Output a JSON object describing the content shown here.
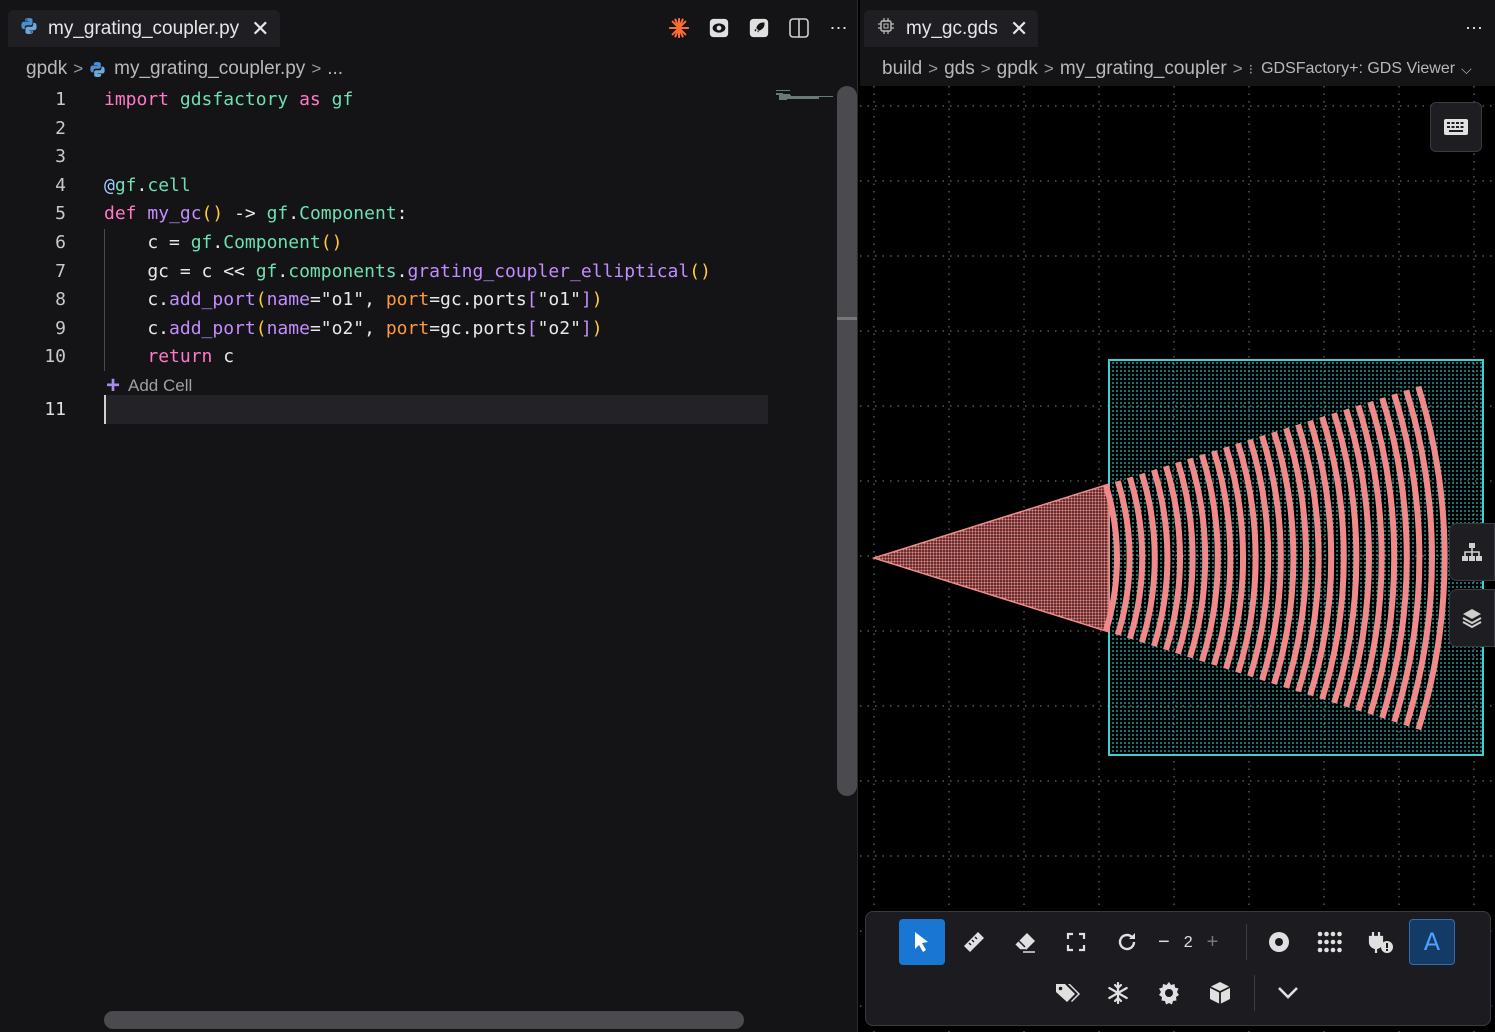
{
  "editor": {
    "tab": {
      "label": "my_grating_coupler.py",
      "close": "✕"
    },
    "breadcrumb": [
      "gpdk",
      "my_grating_coupler.py",
      "..."
    ],
    "lines": [
      {
        "n": "1",
        "tokens": [
          [
            "k",
            "import"
          ],
          [
            "w",
            " "
          ],
          [
            "m",
            "gdsfactory"
          ],
          [
            "w",
            " "
          ],
          [
            "k",
            "as"
          ],
          [
            "w",
            " "
          ],
          [
            "m",
            "gf"
          ]
        ]
      },
      {
        "n": "2",
        "tokens": []
      },
      {
        "n": "3",
        "tokens": []
      },
      {
        "n": "4",
        "tokens": [
          [
            "d",
            "@"
          ],
          [
            "m",
            "gf"
          ],
          [
            "w",
            "."
          ],
          [
            "m",
            "cell"
          ]
        ]
      },
      {
        "n": "5",
        "tokens": [
          [
            "k",
            "def"
          ],
          [
            "w",
            " "
          ],
          [
            "f",
            "my_gc"
          ],
          [
            "p",
            "()"
          ],
          [
            "w",
            " -> "
          ],
          [
            "m",
            "gf"
          ],
          [
            "w",
            "."
          ],
          [
            "m",
            "Component"
          ],
          [
            "w",
            ":"
          ]
        ]
      },
      {
        "n": "6",
        "tokens": [
          [
            "w",
            "    c = "
          ],
          [
            "m",
            "gf"
          ],
          [
            "w",
            "."
          ],
          [
            "m",
            "Component"
          ],
          [
            "p",
            "()"
          ]
        ]
      },
      {
        "n": "7",
        "tokens": [
          [
            "w",
            "    gc = c << "
          ],
          [
            "m",
            "gf"
          ],
          [
            "w",
            "."
          ],
          [
            "m",
            "components"
          ],
          [
            "w",
            "."
          ],
          [
            "f",
            "grating_coupler_elliptical"
          ],
          [
            "p",
            "()"
          ]
        ]
      },
      {
        "n": "8",
        "tokens": [
          [
            "w",
            "    c."
          ],
          [
            "f",
            "add_port"
          ],
          [
            "p",
            "("
          ],
          [
            "f",
            "name"
          ],
          [
            "w",
            "="
          ],
          [
            "w",
            "\"o1\""
          ],
          [
            "w",
            ", "
          ],
          [
            "a",
            "port"
          ],
          [
            "w",
            "=gc.ports"
          ],
          [
            "f",
            "["
          ],
          [
            "w",
            "\"o1\""
          ],
          [
            "f",
            "]"
          ],
          [
            "p",
            ")"
          ]
        ]
      },
      {
        "n": "9",
        "tokens": [
          [
            "w",
            "    c."
          ],
          [
            "f",
            "add_port"
          ],
          [
            "p",
            "("
          ],
          [
            "f",
            "name"
          ],
          [
            "w",
            "="
          ],
          [
            "w",
            "\"o2\""
          ],
          [
            "w",
            ", "
          ],
          [
            "a",
            "port"
          ],
          [
            "w",
            "=gc.ports"
          ],
          [
            "f",
            "["
          ],
          [
            "w",
            "\"o2\""
          ],
          [
            "f",
            "]"
          ],
          [
            "p",
            ")"
          ]
        ]
      },
      {
        "n": "10",
        "tokens": [
          [
            "w",
            "    "
          ],
          [
            "k",
            "return"
          ],
          [
            "w",
            " c"
          ]
        ]
      }
    ],
    "add_cell_label": "Add Cell",
    "cell_line_number": "11"
  },
  "viewer": {
    "tab": {
      "label": "my_gc.gds",
      "close": "✕"
    },
    "breadcrumb": [
      "build",
      "gds",
      "gpdk",
      "my_grating_coupler"
    ],
    "viewer_name": "GDSFactory+: GDS Viewer",
    "zoom_level": "2",
    "colors": {
      "waveguide": "#f08a8a",
      "clad": "#3ad1d1",
      "accent": "#1976d2"
    }
  },
  "icons": {
    "python": "python-icon",
    "gds": "chip-icon"
  }
}
